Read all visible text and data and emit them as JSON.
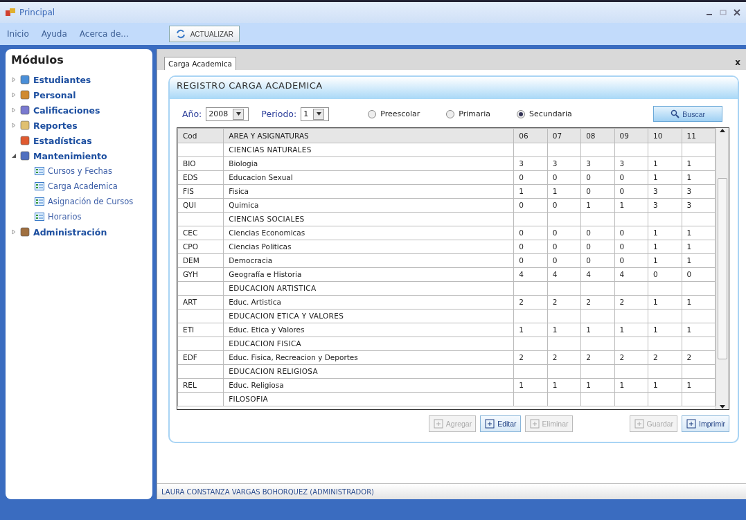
{
  "window": {
    "title": "Principal"
  },
  "menu": [
    "Inicio",
    "Ayuda",
    "Acerca de..."
  ],
  "toolbar_button": "ACTUALIZAR",
  "sidebar": {
    "title": "Módulos",
    "items": [
      {
        "label": "Estudiantes",
        "expanded": false
      },
      {
        "label": "Personal",
        "expanded": false
      },
      {
        "label": "Calificaciones",
        "expanded": false
      },
      {
        "label": "Reportes",
        "expanded": false
      },
      {
        "label": "Estadísticas"
      },
      {
        "label": "Mantenimiento",
        "expanded": true,
        "children": [
          {
            "label": "Cursos y Fechas"
          },
          {
            "label": "Carga Academica"
          },
          {
            "label": "Asignación de Cursos"
          },
          {
            "label": "Horarios"
          }
        ]
      },
      {
        "label": "Administración",
        "expanded": false
      }
    ]
  },
  "tab": {
    "label": "Carga Academica",
    "close": "x"
  },
  "panel": {
    "title": "REGISTRO CARGA ACADEMICA",
    "year": {
      "label": "Año:",
      "value": "2008"
    },
    "period": {
      "label": "Periodo:",
      "value": "1"
    },
    "levels": [
      {
        "label": "Preescolar",
        "selected": false
      },
      {
        "label": "Primaria",
        "selected": false
      },
      {
        "label": "Secundaria",
        "selected": true
      }
    ],
    "search_button": "Buscar"
  },
  "table": {
    "columns": [
      "Cod",
      "AREA Y ASIGNATURAS",
      "06",
      "07",
      "08",
      "09",
      "10",
      "11"
    ],
    "rows": [
      {
        "kind": "group",
        "cells": [
          "",
          "CIENCIAS NATURALES",
          "",
          "",
          "",
          "",
          "",
          ""
        ]
      },
      {
        "kind": "subject",
        "cells": [
          "BIO",
          "Biologia",
          "3",
          "3",
          "3",
          "3",
          "1",
          "1"
        ]
      },
      {
        "kind": "subject",
        "cells": [
          "EDS",
          "Educacion Sexual",
          "0",
          "0",
          "0",
          "0",
          "1",
          "1"
        ]
      },
      {
        "kind": "subject",
        "cells": [
          "FIS",
          "Fisica",
          "1",
          "1",
          "0",
          "0",
          "3",
          "3"
        ]
      },
      {
        "kind": "subject",
        "cells": [
          "QUI",
          "Quimica",
          "0",
          "0",
          "1",
          "1",
          "3",
          "3"
        ]
      },
      {
        "kind": "group",
        "cells": [
          "",
          "CIENCIAS SOCIALES",
          "",
          "",
          "",
          "",
          "",
          ""
        ]
      },
      {
        "kind": "subject",
        "cells": [
          "CEC",
          "Ciencias Economicas",
          "0",
          "0",
          "0",
          "0",
          "1",
          "1"
        ]
      },
      {
        "kind": "subject",
        "cells": [
          "CPO",
          "Ciencias Politicas",
          "0",
          "0",
          "0",
          "0",
          "1",
          "1"
        ]
      },
      {
        "kind": "subject",
        "cells": [
          "DEM",
          "Democracia",
          "0",
          "0",
          "0",
          "0",
          "1",
          "1"
        ]
      },
      {
        "kind": "subject",
        "cells": [
          "GYH",
          "Geografía e Historia",
          "4",
          "4",
          "4",
          "4",
          "0",
          "0"
        ]
      },
      {
        "kind": "group",
        "cells": [
          "",
          "EDUCACION ARTISTICA",
          "",
          "",
          "",
          "",
          "",
          ""
        ]
      },
      {
        "kind": "subject",
        "cells": [
          "ART",
          "Educ. Artistica",
          "2",
          "2",
          "2",
          "2",
          "1",
          "1"
        ]
      },
      {
        "kind": "group",
        "cells": [
          "",
          "EDUCACION ETICA Y VALORES",
          "",
          "",
          "",
          "",
          "",
          ""
        ]
      },
      {
        "kind": "subject",
        "cells": [
          "ETI",
          "Educ. Etica y Valores",
          "1",
          "1",
          "1",
          "1",
          "1",
          "1"
        ]
      },
      {
        "kind": "group",
        "cells": [
          "",
          "EDUCACION FISICA",
          "",
          "",
          "",
          "",
          "",
          ""
        ]
      },
      {
        "kind": "subject",
        "cells": [
          "EDF",
          "Educ. Fisica, Recreacion y Deportes",
          "2",
          "2",
          "2",
          "2",
          "2",
          "2"
        ]
      },
      {
        "kind": "group",
        "cells": [
          "",
          "EDUCACION RELIGIOSA",
          "",
          "",
          "",
          "",
          "",
          ""
        ]
      },
      {
        "kind": "subject",
        "cells": [
          "REL",
          "Educ. Religiosa",
          "1",
          "1",
          "1",
          "1",
          "1",
          "1"
        ]
      },
      {
        "kind": "group",
        "cells": [
          "",
          "FILOSOFIA",
          "",
          "",
          "",
          "",
          "",
          ""
        ]
      }
    ]
  },
  "actions": [
    {
      "label": "Agregar",
      "disabled": true
    },
    {
      "label": "Editar",
      "disabled": false
    },
    {
      "label": "Eliminar",
      "disabled": true
    },
    {
      "label": "Guardar",
      "disabled": true
    },
    {
      "label": "Imprimir",
      "disabled": false
    }
  ],
  "status_bar": "LAURA CONSTANZA VARGAS BOHORQUEZ (ADMINISTRADOR)"
}
